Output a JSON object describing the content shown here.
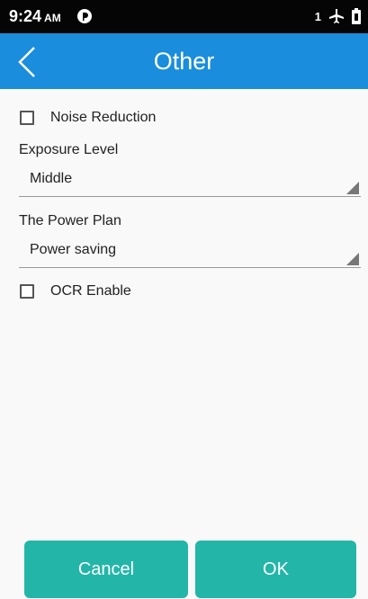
{
  "status_bar": {
    "time": "9:24",
    "ampm": "AM",
    "sim_slot": "1",
    "icons": [
      "notification-icon",
      "airplane-icon",
      "battery-icon"
    ]
  },
  "app_bar": {
    "title": "Other",
    "back_icon": "chevron-left-icon"
  },
  "form": {
    "noise_reduction": {
      "label": "Noise Reduction",
      "checked": false
    },
    "exposure_level": {
      "label": "Exposure Level",
      "value": "Middle"
    },
    "power_plan": {
      "label": "The Power Plan",
      "value": "Power saving"
    },
    "ocr_enable": {
      "label": "OCR Enable",
      "checked": false
    }
  },
  "buttons": {
    "cancel": "Cancel",
    "ok": "OK"
  },
  "colors": {
    "app_bar": "#1a8ddc",
    "button": "#23b6a8",
    "status_bar": "#050505"
  }
}
